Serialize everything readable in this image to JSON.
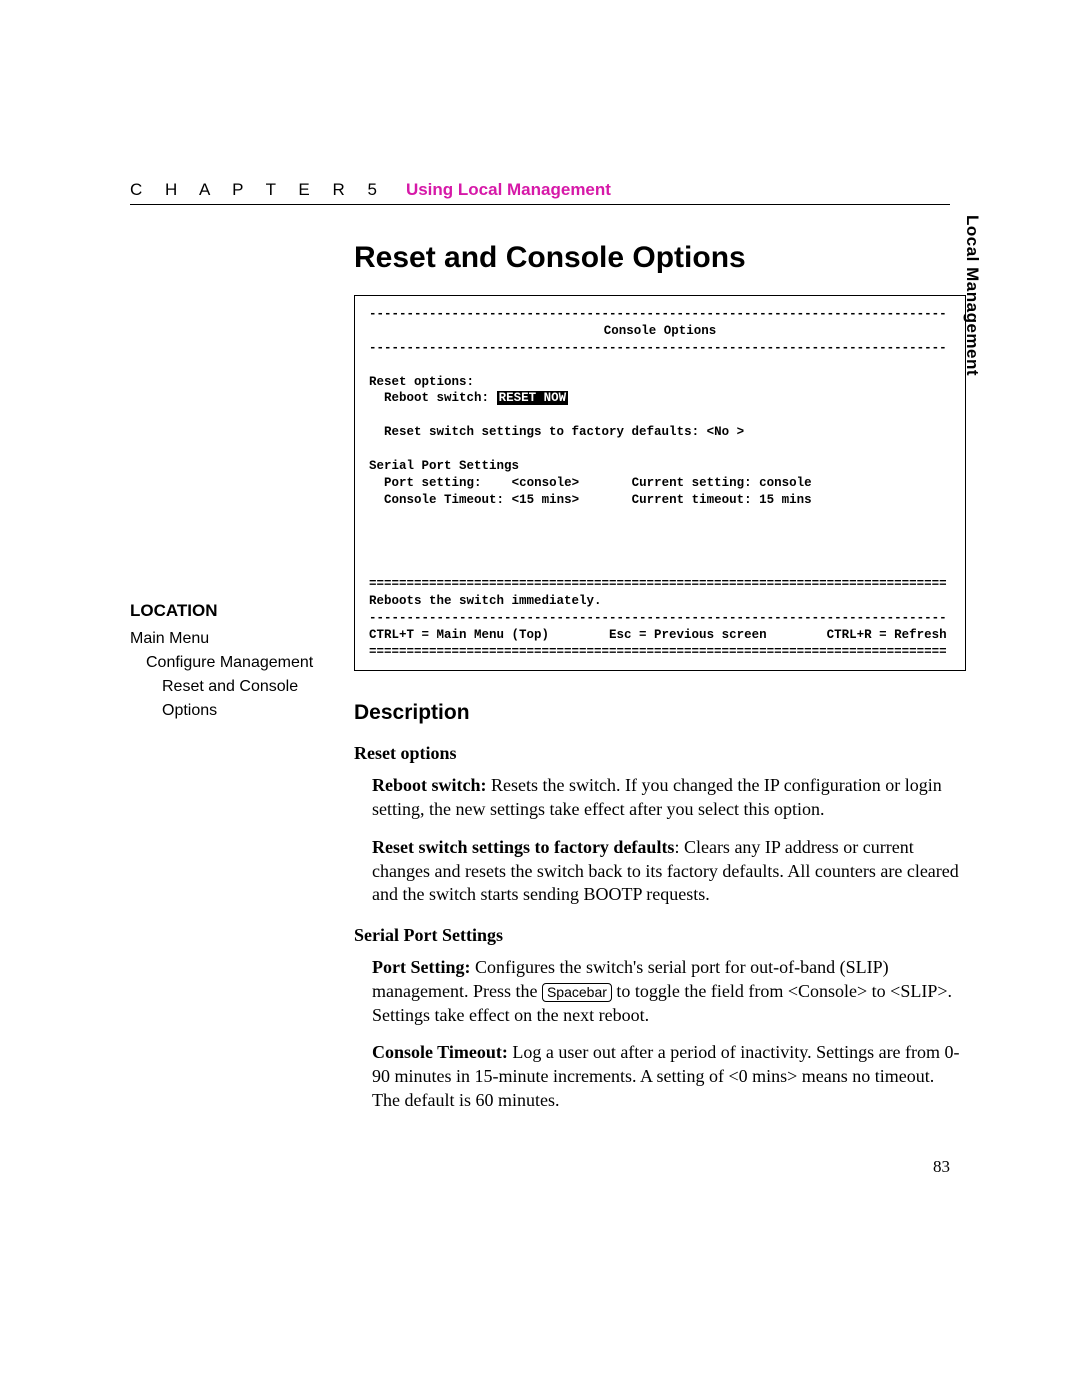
{
  "header": {
    "chapter_word": "C H A P T E R  5",
    "chapter_title": "Using Local Management"
  },
  "tab": {
    "label": "Local Management"
  },
  "title": "Reset and Console Options",
  "console": {
    "dash_rule": "-----------------------------------------------------------------------------",
    "eq_rule": "=============================================================================",
    "screen_title": "Console Options",
    "reset_options_label": "Reset options:",
    "reboot_switch_label": "Reboot switch:",
    "reboot_switch_value": "RESET NOW",
    "reset_factory_line": "Reset switch settings to factory defaults: <No >",
    "serial_header": "Serial Port Settings",
    "port_setting_label": "Port setting:",
    "port_setting_value": "<console>",
    "current_setting_label": "Current setting: console",
    "console_timeout_label": "Console Timeout:",
    "console_timeout_value": "<15 mins>",
    "current_timeout_label": "Current timeout: 15 mins",
    "help_line": "Reboots the switch immediately.",
    "ctrl_t": "CTRL+T = Main Menu (Top)",
    "esc": "Esc = Previous screen",
    "ctrl_r": "CTRL+R = Refresh"
  },
  "location": {
    "heading": "LOCATION",
    "l1": "Main Menu",
    "l2": "Configure Management",
    "l3": "Reset and Console Options"
  },
  "description": {
    "heading": "Description",
    "reset_options_head": "Reset options",
    "reboot_b": "Reboot switch:",
    "reboot_txt": " Resets the switch. If you changed the IP configuration or login setting, the new settings take effect after you select this option.",
    "factory_b": "Reset switch settings to factory defaults",
    "factory_txt": ": Clears any IP address or current changes and resets the switch back to its factory defaults. All counters are cleared and the switch starts sending BOOTP requests.",
    "serial_head": "Serial Port Settings",
    "port_b": "Port Setting:",
    "port_txt_a": " Configures the switch's serial port for out-of-band (SLIP) management. Press the ",
    "port_key": "Spacebar",
    "port_txt_b": " to toggle the field from <Console> to <SLIP>. Settings take effect on the next reboot.",
    "timeout_b": "Console Timeout:",
    "timeout_txt": " Log a user out after a period of inactivity. Settings are from 0-90 minutes in 15-minute increments. A setting of <0 mins> means no timeout. The default is 60 minutes."
  },
  "page_number": "83"
}
